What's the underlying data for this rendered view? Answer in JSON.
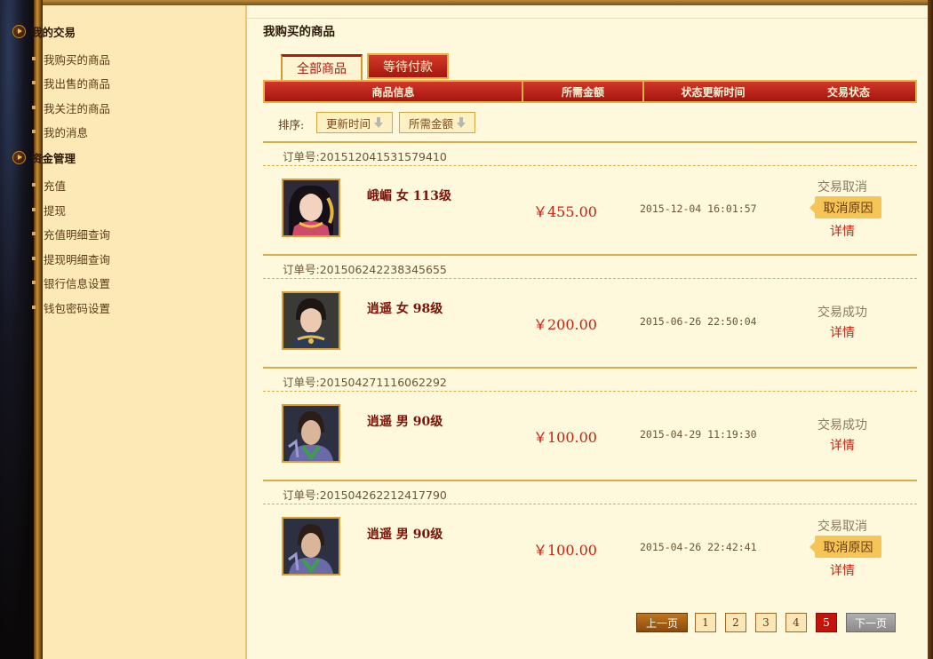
{
  "sidebar": {
    "groups": [
      {
        "label": "我的交易",
        "items": [
          "我购买的商品",
          "我出售的商品",
          "我关注的商品",
          "我的消息"
        ]
      },
      {
        "label": "资金管理",
        "items": [
          "充值",
          "提现",
          "充值明细查询",
          "提现明细查询",
          "银行信息设置",
          "钱包密码设置"
        ]
      }
    ]
  },
  "main": {
    "title": "我购买的商品",
    "tabs": [
      {
        "label": "全部商品",
        "active": true
      },
      {
        "label": "等待付款",
        "active": false
      }
    ],
    "table_headers": [
      "商品信息",
      "所需金额",
      "状态更新时间",
      "交易状态"
    ],
    "sort": {
      "label": "排序:",
      "options": [
        "更新时间",
        "所需金额"
      ]
    },
    "order_prefix": "订单号:",
    "cancel_reason_label": "取消原因",
    "detail_label": "详情",
    "orders": [
      {
        "order_no": "201512041531579410",
        "name": "峨嵋 女 113级",
        "price": "￥455.00",
        "time": "2015-12-04 16:01:57",
        "status": "交易取消",
        "cancelled": true
      },
      {
        "order_no": "201506242238345655",
        "name": "逍遥 女 98级",
        "price": "￥200.00",
        "time": "2015-06-26 22:50:04",
        "status": "交易成功",
        "cancelled": false
      },
      {
        "order_no": "201504271116062292",
        "name": "逍遥 男 90级",
        "price": "￥100.00",
        "time": "2015-04-29 11:19:30",
        "status": "交易成功",
        "cancelled": false
      },
      {
        "order_no": "201504262212417790",
        "name": "逍遥 男 90级",
        "price": "￥100.00",
        "time": "2015-04-26 22:42:41",
        "status": "交易取消",
        "cancelled": true
      }
    ],
    "pagination": {
      "prev": "上一页",
      "next": "下一页",
      "pages": [
        "1",
        "2",
        "3",
        "4",
        "5"
      ],
      "current": "5"
    }
  },
  "colors": {
    "accent_red": "#d1200e",
    "header_red": "#b11a10",
    "gold_border": "#d9ad4a",
    "sidebar_bg": "#fde9b5",
    "content_bg": "#fef8dc"
  }
}
